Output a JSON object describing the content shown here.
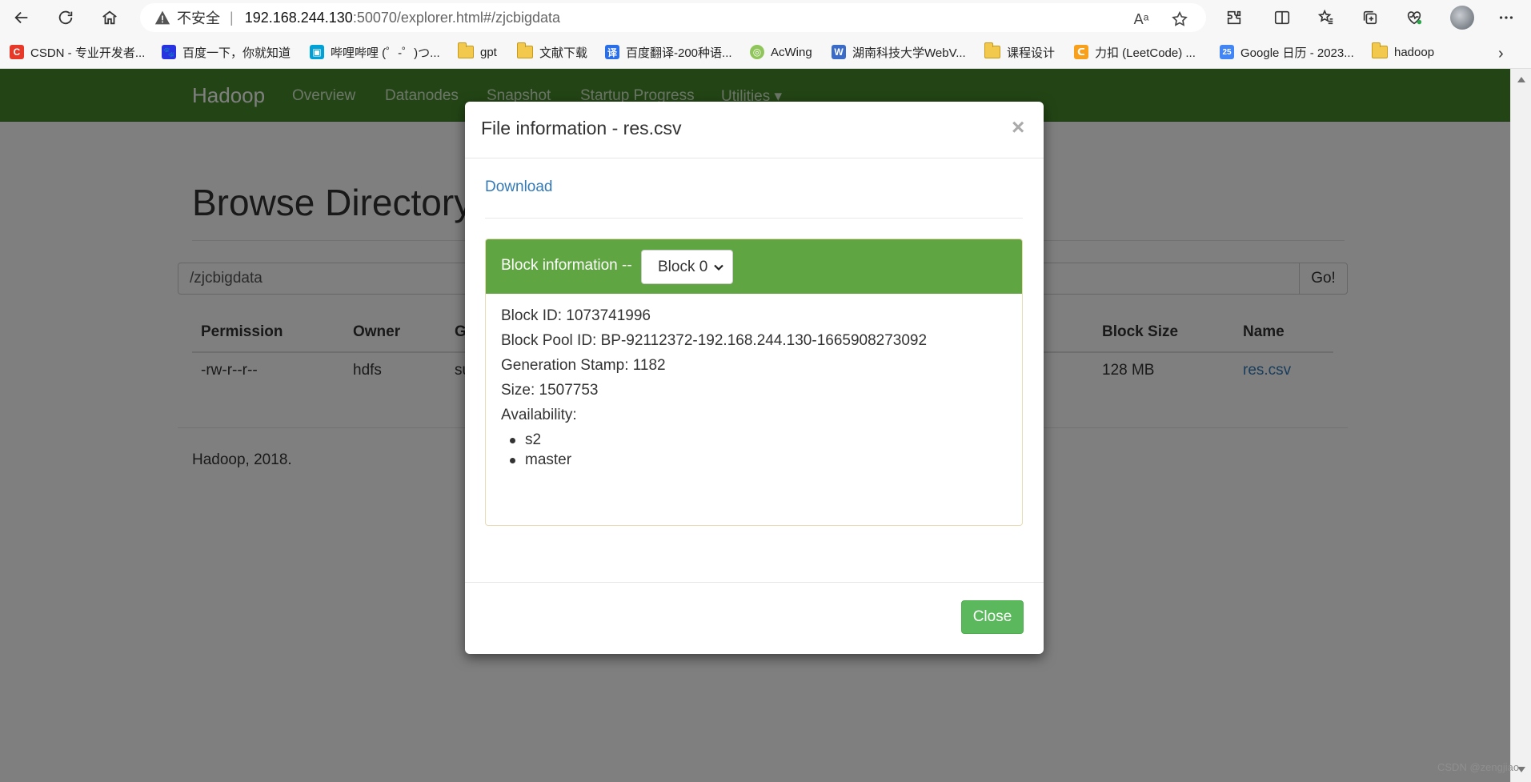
{
  "browser": {
    "insecure_label": "不安全",
    "url_separator": "|",
    "url_host": "192.168.244.130",
    "url_rest": ":50070/explorer.html#/zjcbigdata",
    "read_aloud_label": "Aᵃ",
    "bookmarks": [
      {
        "label": "CSDN - 专业开发者...",
        "icon": "csdn-icon",
        "icon_text": "C",
        "color": "#e83828"
      },
      {
        "label": "百度一下，你就知道",
        "icon": "baidu-icon",
        "icon_text": "🐾",
        "color": "#2932e1"
      },
      {
        "label": "哔哩哔哩 (゜-゜)つ...",
        "icon": "bilibili-icon",
        "icon_text": "▣",
        "color": "#00a1d6"
      },
      {
        "label": "gpt",
        "icon": "folder-icon"
      },
      {
        "label": "文献下载",
        "icon": "folder-icon"
      },
      {
        "label": "百度翻译-200种语...",
        "icon": "baidu-translate-icon",
        "icon_text": "译",
        "color": "#2b6fe8"
      },
      {
        "label": "AcWing",
        "icon": "acwing-icon",
        "icon_text": "◎",
        "color": "#8fc55a"
      },
      {
        "label": "湖南科技大学WebV...",
        "icon": "webvpn-icon",
        "icon_text": "W",
        "color": "#3a6bc8"
      },
      {
        "label": "课程设计",
        "icon": "folder-icon"
      },
      {
        "label": "力扣 (LeetCode) ...",
        "icon": "leetcode-icon",
        "icon_text": "ᑕ",
        "color": "#f89f1b"
      },
      {
        "label": "Google 日历 - 2023...",
        "icon": "google-calendar-icon",
        "icon_text": "25",
        "color": "#4285f4"
      },
      {
        "label": "hadoop",
        "icon": "folder-icon"
      }
    ],
    "more_label": "›"
  },
  "hadoop": {
    "brand": "Hadoop",
    "nav": [
      "Overview",
      "Datanodes",
      "Snapshot",
      "Startup Progress",
      "Utilities ▾"
    ],
    "heading": "Browse Directory",
    "path_value": "/zjcbigdata",
    "go_label": "Go!",
    "columns": [
      "Permission",
      "Owner",
      "G",
      "Block Size",
      "Name"
    ],
    "row": {
      "permission": "-rw-r--r--",
      "owner": "hdfs",
      "group": "su",
      "block_size": "128 MB",
      "name": "res.csv"
    },
    "footer": "Hadoop, 2018."
  },
  "modal": {
    "title": "File information - res.csv",
    "close_x": "×",
    "download_label": "Download",
    "block_info_label": "Block information --",
    "block_selected": "Block 0",
    "block_id": "Block ID: 1073741996",
    "block_pool_id": "Block Pool ID: BP-92112372-192.168.244.130-1665908273092",
    "generation_stamp": "Generation Stamp: 1182",
    "size": "Size: 1507753",
    "availability_label": "Availability:",
    "availability": [
      "s2",
      "master"
    ],
    "close_label": "Close"
  },
  "watermark": "CSDN @zengjiao"
}
